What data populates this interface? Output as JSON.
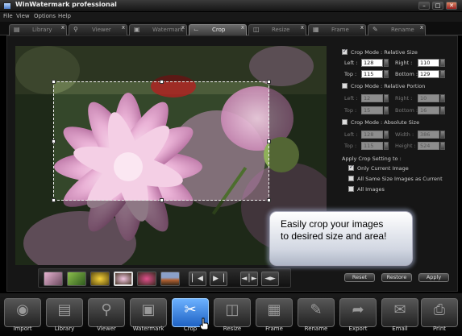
{
  "app": {
    "title": "WinWatermark professional",
    "window_controls": [
      "–",
      "□",
      "✕"
    ]
  },
  "menu": [
    "File",
    "View",
    "Options",
    "Help"
  ],
  "tabs": [
    {
      "label": "Library",
      "icon": "library-icon",
      "close": "x"
    },
    {
      "label": "Viewer",
      "icon": "magnifier-icon",
      "close": "x"
    },
    {
      "label": "Watermark",
      "icon": "lock-icon",
      "close": "x"
    },
    {
      "label": "Crop",
      "icon": "crop-icon",
      "close": "x"
    },
    {
      "label": "Resize",
      "icon": "resize-icon",
      "close": "x"
    },
    {
      "label": "Frame",
      "icon": "frame-icon",
      "close": "x"
    },
    {
      "label": "Rename",
      "icon": "pencil-icon",
      "close": "x"
    }
  ],
  "active_tab": "Crop",
  "crop_panel": {
    "relative_size": {
      "label": "Crop Mode : Relative Size",
      "checked": true,
      "left": "128",
      "right": "110",
      "top": "115",
      "bottom": "129"
    },
    "relative_portion": {
      "label": "Crop Mode : Relative Portion",
      "checked": false,
      "left": "12",
      "right": "10",
      "top": "15",
      "bottom": "16"
    },
    "absolute_size": {
      "label": "Crop Mode : Absolute Size",
      "checked": false,
      "left": "128",
      "width": "386",
      "top": "115",
      "height": "524"
    },
    "field_labels": {
      "left": "Left :",
      "right": "Right :",
      "top": "Top :",
      "bottom": "Bottom :",
      "width": "Width :",
      "height": "Height :"
    },
    "apply_setting": {
      "label": "Apply Crop Setting to :",
      "options": [
        {
          "label": "Only Current Image",
          "checked": true
        },
        {
          "label": "All Same Size Images as Current",
          "checked": false
        },
        {
          "label": "All Images",
          "checked": false
        }
      ]
    },
    "buttons": {
      "reset": "Reset",
      "restore": "Restore",
      "apply": "Apply"
    }
  },
  "thumb_navigation": {
    "first": "▏◀",
    "last": "▶▕",
    "fit_width": "◄│►",
    "fit_screen": "◄►"
  },
  "callout": {
    "line1": "Easily crop your images",
    "line2": "to desired size and area!"
  },
  "toolbar": [
    {
      "label": "Import",
      "icon": "camera-icon"
    },
    {
      "label": "Library",
      "icon": "library-icon"
    },
    {
      "label": "Viewer",
      "icon": "magnifier-icon"
    },
    {
      "label": "Watermark",
      "icon": "lock-icon"
    },
    {
      "label": "Crop",
      "icon": "scissors-icon"
    },
    {
      "label": "Resize",
      "icon": "resize-icon"
    },
    {
      "label": "Frame",
      "icon": "frame-icon"
    },
    {
      "label": "Rename",
      "icon": "rename-icon"
    },
    {
      "label": "Export",
      "icon": "export-icon"
    },
    {
      "label": "Email",
      "icon": "envelope-icon"
    },
    {
      "label": "Print",
      "icon": "printer-icon"
    }
  ],
  "colors": {
    "accent": "#2f7fe6",
    "flower": "#e9a9d0",
    "foliage": "#37512a"
  }
}
